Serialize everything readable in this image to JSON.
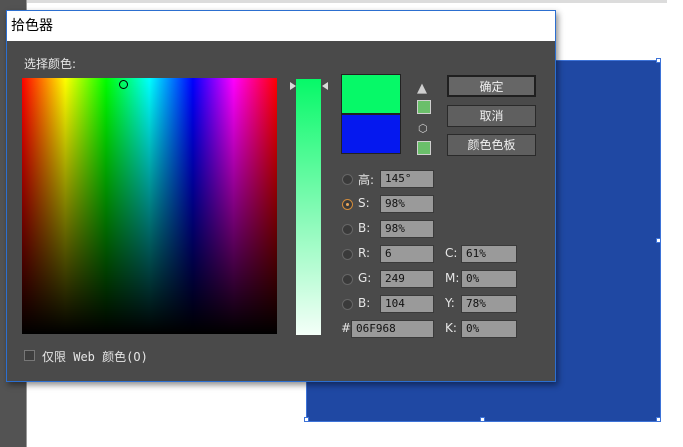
{
  "dialog": {
    "title": "拾色器",
    "select_color_label": "选择颜色:",
    "buttons": {
      "ok": "确定",
      "cancel": "取消",
      "swatches": "颜色色板"
    },
    "warning_icon": "warning-triangle-icon",
    "cube_icon": "cube-icon",
    "new_color": "#06f968",
    "old_color": "#0518ef",
    "hsb": [
      {
        "label": "H:",
        "display": "高:",
        "value": "145°"
      },
      {
        "label": "S:",
        "display": "S:",
        "value": "98%"
      },
      {
        "label": "B:",
        "display": "B:",
        "value": "98%"
      }
    ],
    "rgb": [
      {
        "label": "R:",
        "value": "6"
      },
      {
        "label": "G:",
        "value": "249"
      },
      {
        "label": "B:",
        "value": "104"
      }
    ],
    "cmyk": [
      {
        "label": "C:",
        "value": "61%"
      },
      {
        "label": "M:",
        "value": "0%"
      },
      {
        "label": "Y:",
        "value": "78%"
      },
      {
        "label": "K:",
        "value": "0%"
      }
    ],
    "hex_label": "#",
    "hex_value": "06F968",
    "web_only_label": "仅限 Web 颜色(O)"
  },
  "canvas": {
    "shape_color": "#1f48a3"
  }
}
